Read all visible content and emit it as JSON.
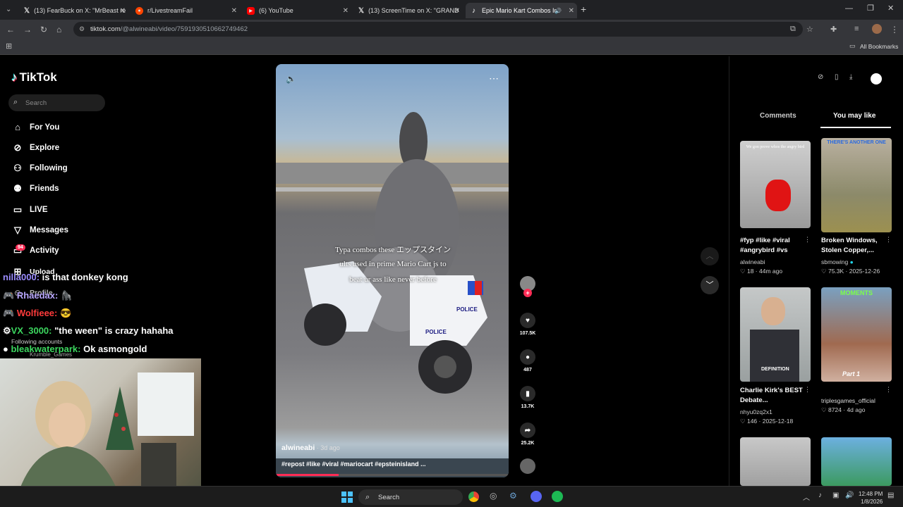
{
  "browser": {
    "tabs": [
      {
        "label": "(13) FearBuck on X: \"MrBeast re",
        "icon": "x-icon"
      },
      {
        "label": "r/LivestreamFail",
        "icon": "reddit-icon"
      },
      {
        "label": "(6) YouTube",
        "icon": "youtube-icon"
      },
      {
        "label": "(13) ScreenTime on X: \"GRAND",
        "icon": "x-icon"
      },
      {
        "label": "Epic Mario Kart Combos In",
        "icon": "tiktok-icon"
      }
    ],
    "url_host": "tiktok.com",
    "url_path": "/@alwineabi/video/7591930510662749462",
    "all_bookmarks": "All Bookmarks"
  },
  "tiktok": {
    "logo": "TikTok",
    "search_placeholder": "Search",
    "nav": [
      {
        "label": "For You",
        "icon": "home-icon"
      },
      {
        "label": "Explore",
        "icon": "compass-icon"
      },
      {
        "label": "Following",
        "icon": "following-icon"
      },
      {
        "label": "Friends",
        "icon": "friends-icon"
      },
      {
        "label": "LIVE",
        "icon": "live-icon"
      },
      {
        "label": "Messages",
        "icon": "messages-icon"
      },
      {
        "label": "Activity",
        "icon": "activity-icon",
        "badge": "94"
      },
      {
        "label": "Upload",
        "icon": "upload-icon"
      },
      {
        "label": "Profile",
        "icon": "profile-icon"
      }
    ],
    "following_accounts": "Following accounts",
    "following_account_1": "Krumble_Games"
  },
  "video": {
    "caption_line1": "Typa combos these エップスタイン",
    "caption_line2": "ults used in prime Mario Cart js to",
    "caption_line3": "beat ur ass like never before",
    "author": "alwineabi",
    "posted": " · 3d ago",
    "description": "#repost #like #viral #mariocart #epsteinisland ...",
    "likes": "107.5K",
    "comments": "487",
    "saves": "13.7K",
    "shares": "25.2K",
    "police_label": "POLICE"
  },
  "right_panel": {
    "tab_comments": "Comments",
    "tab_you_may_like": "You may like",
    "cards": [
      {
        "title": "#fyp #like #viral #angrybird #vs",
        "author": "alwineabi",
        "meta": "♡ 18 · 44m ago",
        "thumb_text": "We gon prove whos the angry bird"
      },
      {
        "title": "Broken Windows, Stolen Copper,...",
        "author": "sbmowing",
        "meta": "♡ 75.3K · 2025-12-26",
        "thumb_text": "THERE'S ANOTHER ONE"
      },
      {
        "title": "Charlie Kirk's BEST Debate...",
        "author": "nhyu0zq2x1",
        "meta": "♡ 146 · 2025-12-18",
        "thumb_text": "DEFINITION"
      },
      {
        "title": "",
        "author": "triplesgames_official",
        "meta": "♡ 8724 · 4d ago",
        "thumb_text": "MOMENTS",
        "thumb_text2": "Part 1"
      }
    ]
  },
  "stream_chat": [
    {
      "user": "nilla000:",
      "msg": " is that donkey kong",
      "color": "#9b8cff"
    },
    {
      "user": "Rhaedax:",
      "msg": "",
      "color": "#b9a7ff"
    },
    {
      "user": "Wolfieee:",
      "msg": "",
      "color": "#ff3b3b"
    },
    {
      "user": "VX_3000:",
      "msg": " \"the ween\" is crazy hahaha",
      "color": "#3cd75f"
    },
    {
      "user": "bleakwaterpark:",
      "msg": " Ok asmongold",
      "color": "#3cd75f"
    }
  ],
  "taskbar": {
    "search": "Search",
    "time": "12:48 PM",
    "date": "1/8/2026"
  },
  "colors": {
    "accent": "#fe2c55",
    "bg": "#000000",
    "chrome": "#35363a"
  }
}
